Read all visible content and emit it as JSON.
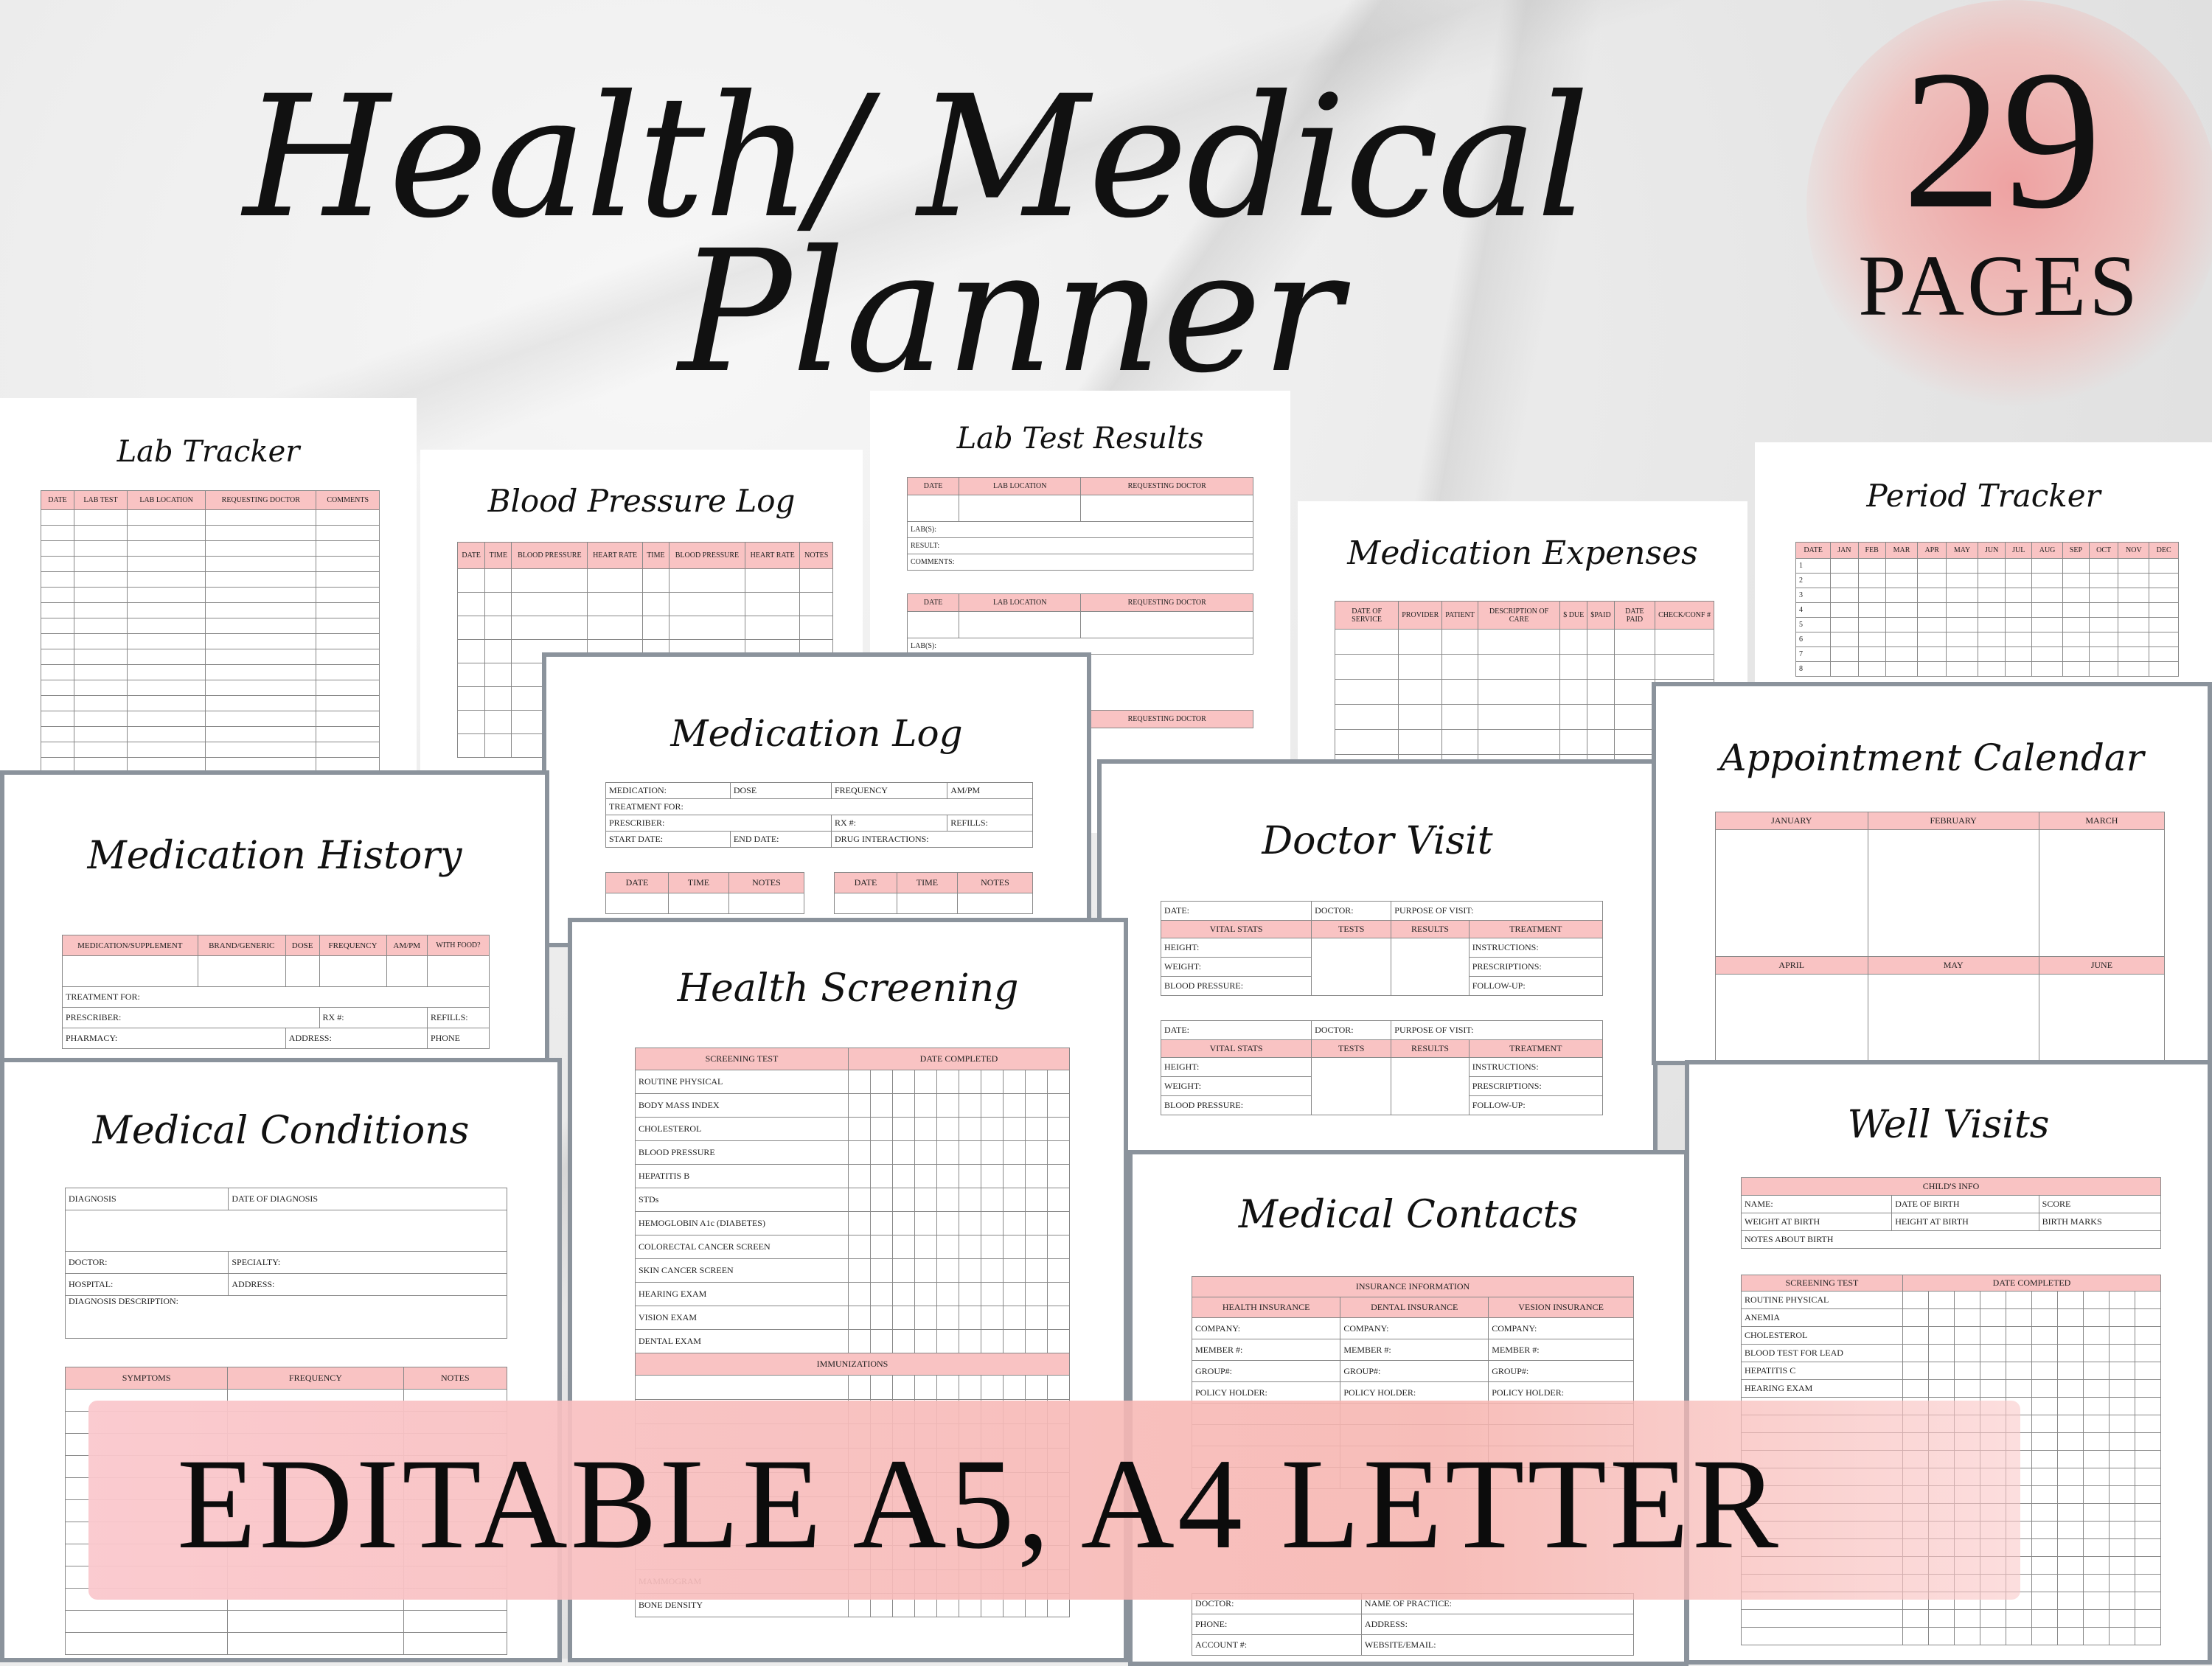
{
  "header": {
    "title_line1": "Health/ Medical",
    "title_line2": "Planner",
    "page_count": "29",
    "page_count_label": "PAGES"
  },
  "banner": {
    "text": "EDITABLE  A5, A4 LETTER"
  },
  "pages": {
    "lab_tracker": {
      "title": "Lab Tracker",
      "columns": [
        "DATE",
        "LAB TEST",
        "LAB LOCATION",
        "REQUESTING DOCTOR",
        "COMMENTS"
      ]
    },
    "blood_pressure_log": {
      "title": "Blood Pressure Log",
      "columns": [
        "DATE",
        "TIME",
        "BLOOD PRESSURE",
        "HEART RATE",
        "TIME",
        "BLOOD PRESSURE",
        "HEART RATE",
        "NOTES"
      ]
    },
    "lab_test_results": {
      "title": "Lab Test Results",
      "columns": [
        "DATE",
        "LAB LOCATION",
        "REQUESTING DOCTOR"
      ],
      "rows": [
        "LAB(S):",
        "RESULT:",
        "COMMENTS:"
      ]
    },
    "medication_expenses": {
      "title": "Medication Expenses",
      "columns": [
        "DATE OF SERVICE",
        "PROVIDER",
        "PATIENT",
        "DESCRIPTION OF CARE",
        "$ DUE",
        "$PAID",
        "DATE PAID",
        "CHECK/CONF #"
      ]
    },
    "period_tracker": {
      "title": "Period Tracker",
      "columns": [
        "DATE",
        "JAN",
        "FEB",
        "MAR",
        "APR",
        "MAY",
        "JUN",
        "JUL",
        "AUG",
        "SEP",
        "OCT",
        "NOV",
        "DEC"
      ],
      "rows": [
        "1",
        "2",
        "3",
        "4",
        "5",
        "6",
        "7",
        "8"
      ]
    },
    "medication_log": {
      "title": "Medication Log",
      "fields": [
        "MEDICATION:",
        "DOSE",
        "FREQUENCY",
        "AM/PM",
        "TREATMENT FOR:",
        "PRESCRIBER:",
        "RX #:",
        "REFILLS:",
        "START DATE:",
        "END DATE:",
        "DRUG INTERACTIONS:"
      ],
      "log_columns": [
        "DATE",
        "TIME",
        "NOTES"
      ]
    },
    "medication_history": {
      "title": "Medication History",
      "columns": [
        "MEDICATION/SUPPLEMENT",
        "BRAND/GENERIC",
        "DOSE",
        "FREQUENCY",
        "AM/PM",
        "WITH FOOD?"
      ],
      "fields": [
        "TREATMENT FOR:",
        "PRESCRIBER:",
        "RX #:",
        "REFILLS:",
        "PHARMACY:",
        "ADDRESS:",
        "PHONE"
      ]
    },
    "doctor_visit": {
      "title": "Doctor Visit",
      "fields": [
        "DATE:",
        "DOCTOR:",
        "PURPOSE OF VISIT:"
      ],
      "columns": [
        "VITAL STATS",
        "TESTS",
        "RESULTS",
        "TREATMENT"
      ],
      "left_rows": [
        "HEIGHT:",
        "WEIGHT:",
        "BLOOD PRESSURE:"
      ],
      "right_rows": [
        "INSTRUCTIONS:",
        "PRESCRIPTIONS:",
        "FOLLOW-UP:"
      ]
    },
    "appointment_calendar": {
      "title": "Appointment Calendar",
      "months_top": [
        "JANUARY",
        "FEBRUARY",
        "MARCH"
      ],
      "months_bottom": [
        "APRIL",
        "MAY",
        "JUNE"
      ]
    },
    "health_screening": {
      "title": "Health Screening",
      "columns": [
        "SCREENING TEST",
        "DATE COMPLETED"
      ],
      "tests": [
        "ROUTINE PHYSICAL",
        "BODY MASS INDEX",
        "CHOLESTEROL",
        "BLOOD PRESSURE",
        "HEPATITIS B",
        "STDs",
        "HEMOGLOBIN A1c  (DIABETES)",
        "COLORECTAL CANCER SCREEN",
        "SKIN CANCER SCREEN",
        "HEARING EXAM",
        "VISION EXAM",
        "DENTAL EXAM"
      ],
      "immunizations_header": "IMMUNIZATIONS",
      "bottom_rows": [
        "MAMMOGRAM",
        "BONE DENSITY"
      ]
    },
    "medical_conditions": {
      "title": "Medical Conditions",
      "fields": [
        "DIAGNOSIS",
        "DATE OF DIAGNOSIS",
        "DOCTOR:",
        "SPECIALTY:",
        "HOSPITAL:",
        "ADDRESS:",
        "DIAGNOSIS DESCRIPTION:"
      ],
      "columns": [
        "SYMPTOMS",
        "FREQUENCY",
        "NOTES"
      ]
    },
    "medical_contacts": {
      "title": "Medical Contacts",
      "section_header": "INSURANCE INFORMATION",
      "columns": [
        "HEALTH INSURANCE",
        "DENTAL INSURANCE",
        "VESION INSURANCE"
      ],
      "rows": [
        "COMPANY:",
        "MEMBER #:",
        "GROUP#:",
        "POLICY HOLDER:"
      ],
      "bottom_fields": [
        "DOCTOR:",
        "NAME OF PRACTICE:",
        "PHONE:",
        "ADDRESS:",
        "ACCOUNT #:",
        "WEBSITE/EMAIL:"
      ]
    },
    "well_visits": {
      "title": "Well Visits",
      "info_header": "CHILD'S INFO",
      "info_fields": [
        "NAME:",
        "DATE OF BIRTH",
        "SCORE",
        "WEIGHT AT BIRTH",
        "HEIGHT AT BIRTH",
        "BIRTH MARKS",
        "NOTES ABOUT BIRTH"
      ],
      "columns": [
        "SCREENING TEST",
        "DATE COMPLETED"
      ],
      "tests": [
        "ROUTINE PHYSICAL",
        "ANEMIA",
        "CHOLESTEROL",
        "BLOOD TEST FOR LEAD",
        "HEPATITIS C",
        "HEARING EXAM"
      ]
    }
  }
}
